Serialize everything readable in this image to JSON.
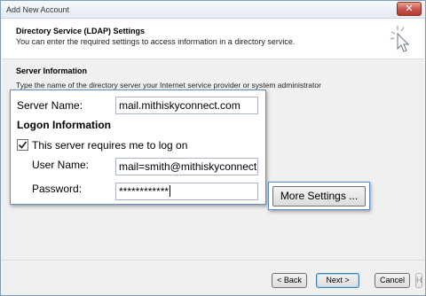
{
  "window": {
    "title": "Add New Account",
    "close_glyph": "✕"
  },
  "header": {
    "title": "Directory Service (LDAP) Settings",
    "subtitle": "You can enter the required settings to access information in a directory service.",
    "icon": "pointer-sparkle-icon"
  },
  "server_information": {
    "heading": "Server Information",
    "description": "Type the name of the directory server your Internet service provider or system administrator"
  },
  "form": {
    "server_name_label": "Server Name:",
    "server_name_value": "mail.mithiskyconnect.com",
    "logon_heading": "Logon Information",
    "requires_logon_label": "This server requires me to log on",
    "requires_logon_checked": true,
    "username_label": "User Name:",
    "username_value": "mail=smith@mithiskyconnect.c",
    "password_label": "Password:",
    "password_value": "************",
    "more_settings_label": "More Settings ..."
  },
  "footer": {
    "back_label": "< Back",
    "next_label": "Next >",
    "cancel_label": "Cancel",
    "help_label": "Help"
  }
}
